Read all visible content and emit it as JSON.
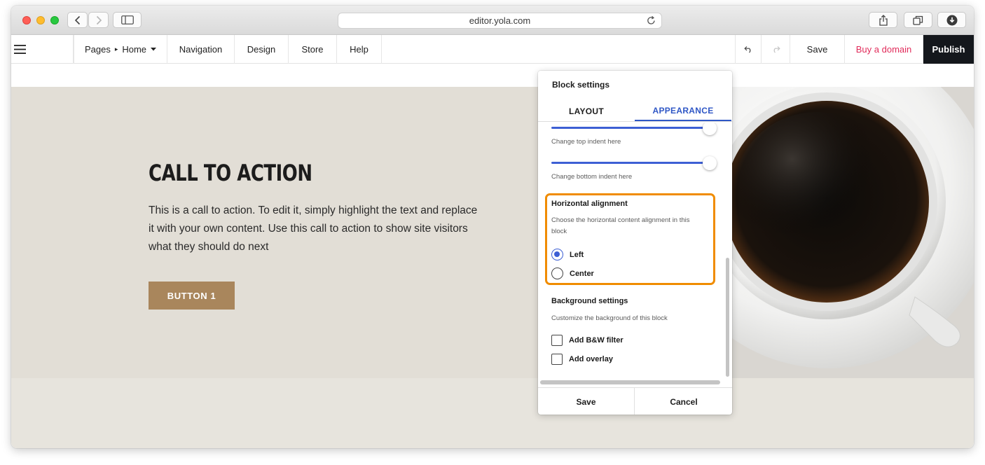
{
  "browser": {
    "url": "editor.yola.com"
  },
  "nav": {
    "pages_label": "Pages",
    "separator": "▸",
    "home_label": "Home",
    "navigation": "Navigation",
    "design": "Design",
    "store": "Store",
    "help": "Help",
    "save": "Save",
    "buy_domain": "Buy a domain",
    "publish": "Publish"
  },
  "hero": {
    "title": "CALL TO ACTION",
    "text": "This is a call to action. To edit it, simply highlight the text and replace it with your own content. Use this call to action to show site visitors what they should do next",
    "button": "BUTTON 1"
  },
  "panel": {
    "title": "Block settings",
    "tabs": [
      "LAYOUT",
      "APPEARANCE"
    ],
    "active_tab": "APPEARANCE",
    "top_indent_hint": "Change top indent here",
    "bottom_indent_hint": "Change bottom indent here",
    "top_indent_value": 1.0,
    "bottom_indent_value": 1.0,
    "alignment": {
      "title": "Horizontal alignment",
      "hint": "Choose the horizontal content alignment in this block",
      "options": [
        "Left",
        "Center"
      ],
      "selected": "Left"
    },
    "background": {
      "title": "Background settings",
      "hint": "Customize the background of this block",
      "options": [
        "Add B&W filter",
        "Add overlay"
      ]
    },
    "footer": {
      "save": "Save",
      "cancel": "Cancel"
    }
  },
  "colors": {
    "accent_blue": "#2f57c6",
    "highlight_orange": "#f08c00",
    "publish_bg": "#14171c",
    "buy_domain": "#e12c5b",
    "cta_button": "#a9865c"
  }
}
